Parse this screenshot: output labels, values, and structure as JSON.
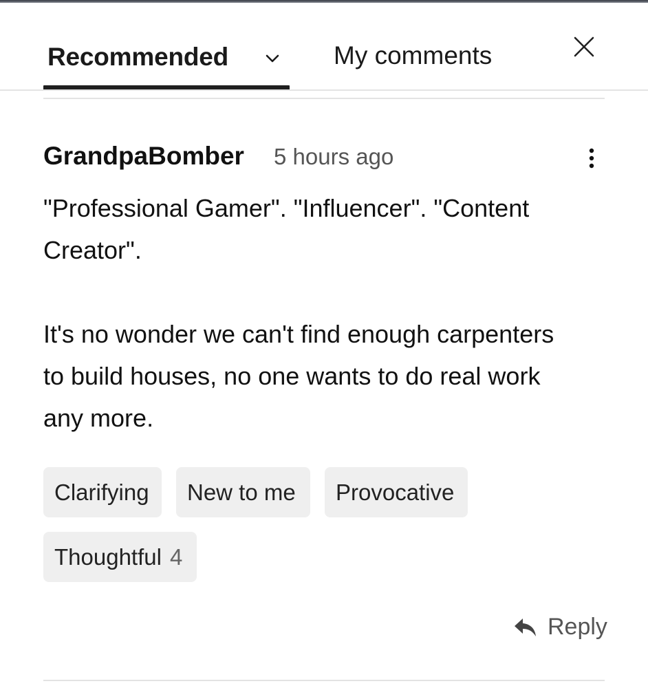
{
  "tabs": {
    "recommended_label": "Recommended",
    "my_comments_label": "My comments",
    "sort_icon": "chevron-down-icon",
    "close_icon": "close-icon"
  },
  "comment": {
    "author": "GrandpaBomber",
    "timestamp": "5 hours ago",
    "menu_icon": "more-vertical-icon",
    "paragraphs": [
      "\"Professional Gamer\". \"Influencer\". \"Content\nCreator\".",
      "It's no wonder we can't find enough carpenters\nto build houses, no one wants to do real work\nany more."
    ],
    "reactions": [
      {
        "label": "Clarifying",
        "count": ""
      },
      {
        "label": "New to me",
        "count": ""
      },
      {
        "label": "Provocative",
        "count": ""
      },
      {
        "label": "Thoughtful",
        "count": "4"
      }
    ],
    "reply_label": "Reply",
    "reply_icon": "reply-arrow-icon"
  }
}
